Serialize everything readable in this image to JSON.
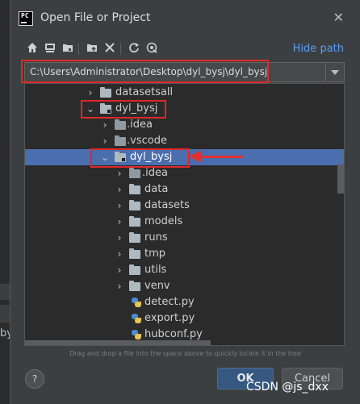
{
  "background": {
    "partial_text": "by"
  },
  "dialog": {
    "app_icon_text": "PC",
    "title": "Open File or Project",
    "close_icon": "close-icon"
  },
  "toolbar": {
    "icons": [
      "home-icon",
      "desktop-icon",
      "project-folder-icon",
      "new-folder-icon",
      "delete-icon",
      "refresh-icon",
      "show-hidden-icon"
    ],
    "hide_path_label": "Hide path"
  },
  "path_field": {
    "value": "C:\\Users\\Administrator\\Desktop\\dyl_bysj\\dyl_bysj"
  },
  "tree": {
    "items": [
      {
        "label": "datasetsall",
        "kind": "folder",
        "depth": 0,
        "expanded": false
      },
      {
        "label": "dyl_bysj",
        "kind": "project-folder",
        "depth": 0,
        "expanded": true
      },
      {
        "label": ".idea",
        "kind": "folder",
        "depth": 1,
        "expanded": false
      },
      {
        "label": ".vscode",
        "kind": "folder",
        "depth": 1,
        "expanded": false
      },
      {
        "label": "dyl_bysj",
        "kind": "project-folder",
        "depth": 1,
        "expanded": true,
        "selected": true
      },
      {
        "label": ".idea",
        "kind": "folder",
        "depth": 2,
        "expanded": false
      },
      {
        "label": "data",
        "kind": "folder",
        "depth": 2,
        "expanded": false
      },
      {
        "label": "datasets",
        "kind": "folder",
        "depth": 2,
        "expanded": false
      },
      {
        "label": "models",
        "kind": "folder",
        "depth": 2,
        "expanded": false
      },
      {
        "label": "runs",
        "kind": "folder",
        "depth": 2,
        "expanded": false
      },
      {
        "label": "tmp",
        "kind": "folder",
        "depth": 2,
        "expanded": false
      },
      {
        "label": "utils",
        "kind": "folder",
        "depth": 2,
        "expanded": false
      },
      {
        "label": "venv",
        "kind": "folder",
        "depth": 2,
        "expanded": false
      },
      {
        "label": "detect.py",
        "kind": "python-file",
        "depth": 2
      },
      {
        "label": "export.py",
        "kind": "python-file",
        "depth": 2
      },
      {
        "label": "hubconf.py",
        "kind": "python-file",
        "depth": 2
      }
    ]
  },
  "hint": "Drag and drop a file into the space above to quickly locate it in the tree",
  "buttons": {
    "help": "?",
    "ok": "OK",
    "cancel": "Cancel"
  },
  "watermark": "CSDN @js_dxx",
  "colors": {
    "selection": "#4b6eaf",
    "link": "#589df6",
    "annotation": "#e02828"
  }
}
